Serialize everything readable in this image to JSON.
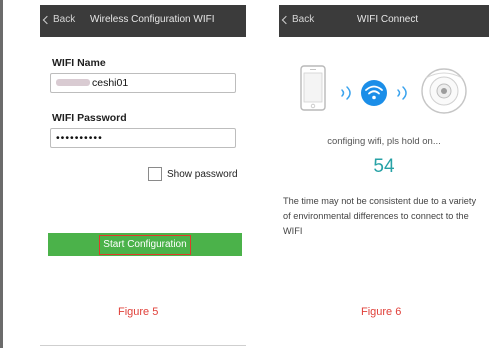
{
  "screens": {
    "left": {
      "back_label": "Back",
      "title": "Wireless Configuration WIFI",
      "wifi_name_label": "WIFI Name",
      "wifi_name_value": "ceshi01",
      "wifi_password_label": "WIFI Password",
      "wifi_password_value": "••••••••••",
      "show_password_label": "Show password",
      "show_password_checked": false,
      "start_button_label": "Start Configuration"
    },
    "right": {
      "back_label": "Back",
      "title": "WIFI Connect",
      "status_text": "configing wifi, pls hold on...",
      "countdown": "54",
      "note": "The time may not be consistent due to a variety of environmental differences to connect to the WIFI"
    }
  },
  "captions": {
    "left": "Figure 5",
    "right": "Figure 6"
  },
  "colors": {
    "topbar": "#3b3b3b",
    "button_green": "#4bb24a",
    "highlight_red": "#e03a2a",
    "caption_red": "#e0403a",
    "countdown_teal": "#27a2a6",
    "wifi_blue": "#1b8ee8"
  },
  "icons": {
    "phone": "smartphone-icon",
    "wifi": "wifi-icon",
    "camera": "camera-device-icon"
  }
}
